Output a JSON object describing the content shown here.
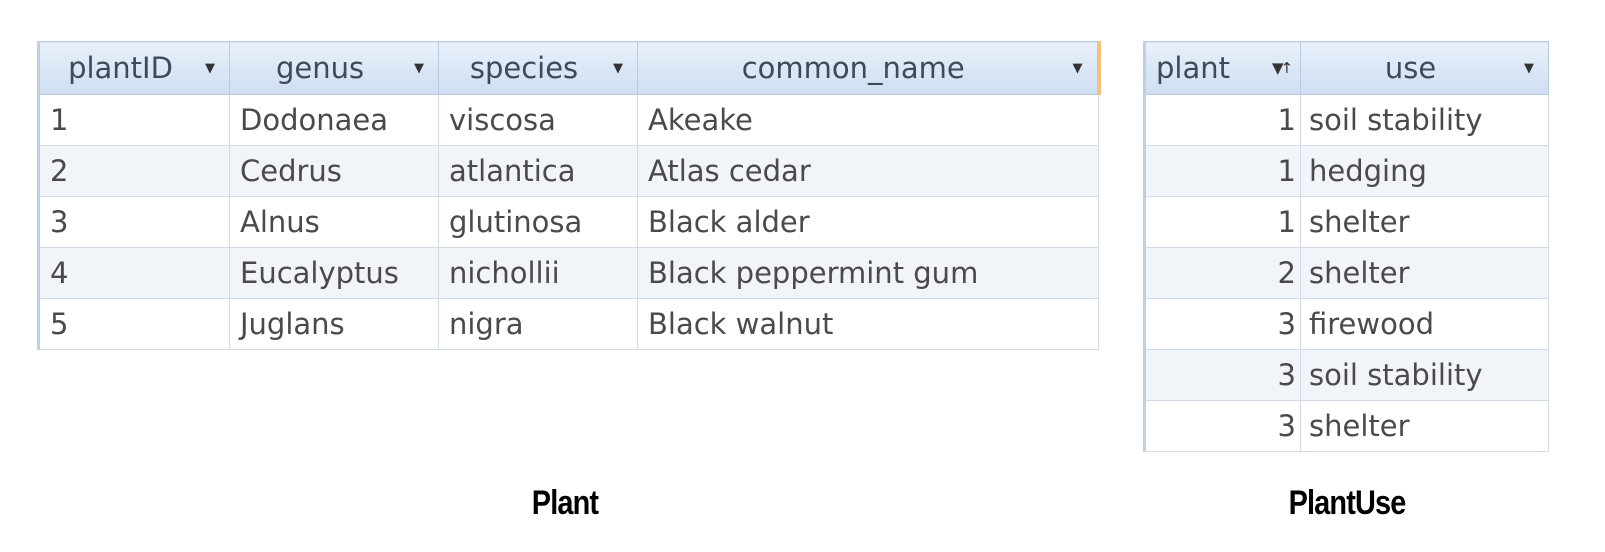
{
  "plant_table": {
    "columns": [
      {
        "label": "plantID",
        "indicator": "dropdown"
      },
      {
        "label": "genus",
        "indicator": "dropdown"
      },
      {
        "label": "species",
        "indicator": "dropdown"
      },
      {
        "label": "common_name",
        "indicator": "dropdown"
      }
    ],
    "rows": [
      [
        "1",
        "Dodonaea",
        "viscosa",
        "Akeake"
      ],
      [
        "2",
        "Cedrus",
        "atlantica",
        "Atlas cedar"
      ],
      [
        "3",
        "Alnus",
        "glutinosa",
        "Black alder"
      ],
      [
        "4",
        "Eucalyptus",
        "nichollii",
        "Black peppermint gum"
      ],
      [
        "5",
        "Juglans",
        "nigra",
        "Black walnut"
      ]
    ],
    "caption": "Plant"
  },
  "plantuse_table": {
    "columns": [
      {
        "label": "plant",
        "indicator": "sort-ascending"
      },
      {
        "label": "use",
        "indicator": "dropdown"
      }
    ],
    "rows": [
      [
        "1",
        "soil stability"
      ],
      [
        "1",
        "hedging"
      ],
      [
        "1",
        "shelter"
      ],
      [
        "2",
        "shelter"
      ],
      [
        "3",
        "firewood"
      ],
      [
        "3",
        "soil stability"
      ],
      [
        "3",
        "shelter"
      ]
    ],
    "caption": "PlantUse"
  },
  "icons": {
    "dropdown": "dropdown-arrow-icon",
    "sort": "sort-ascending-icon"
  },
  "colors": {
    "header_bg": "#d9e6f5",
    "grid_line": "#d3dbe6",
    "alt_row": "#f1f4f8",
    "active_column_edge": "#f2c27b"
  }
}
